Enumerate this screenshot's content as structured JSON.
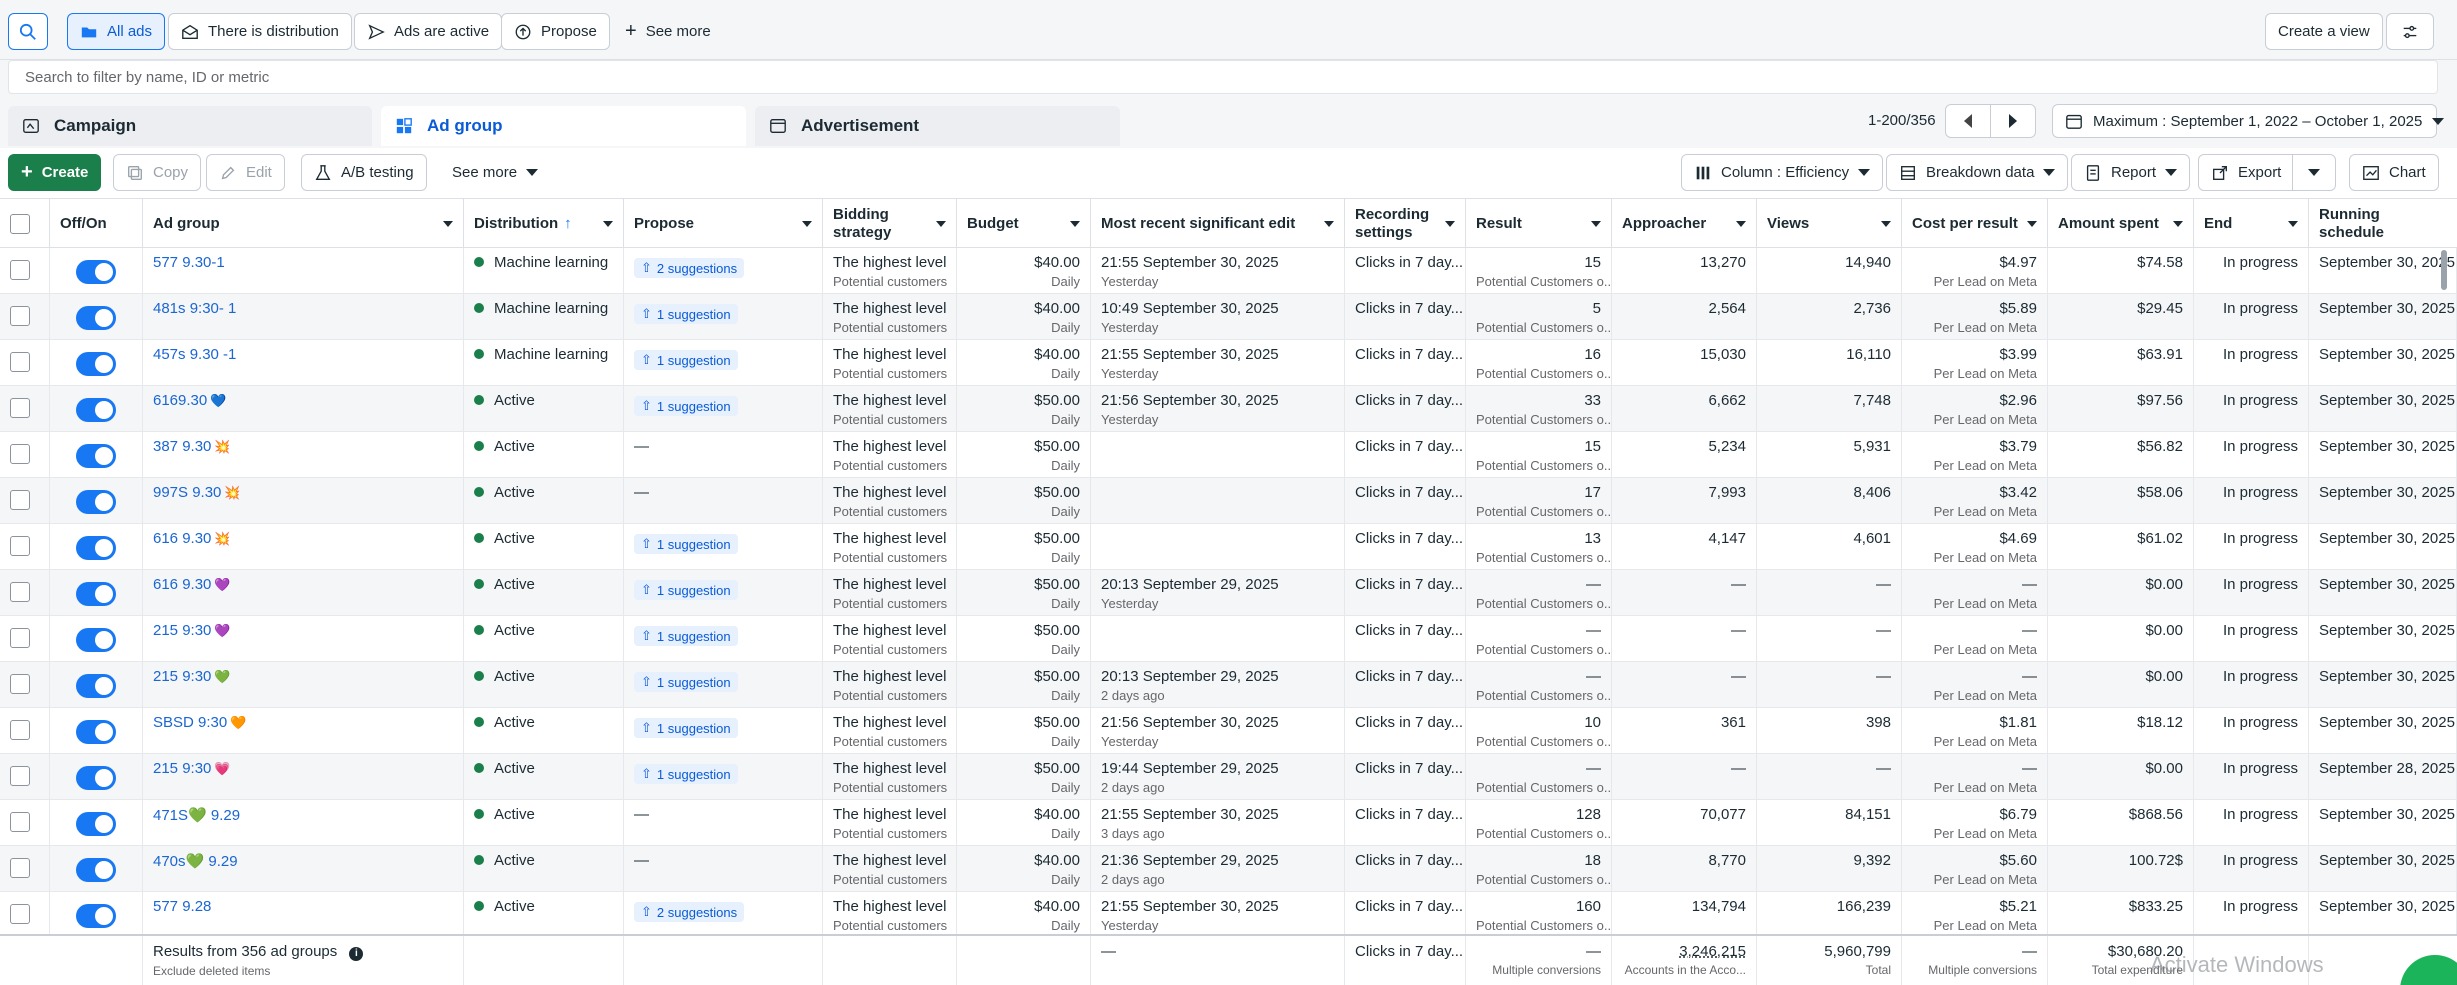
{
  "filters": {
    "all_ads": "All ads",
    "distribution": "There is distribution",
    "active": "Ads are active",
    "propose": "Propose",
    "see_more": "See more",
    "create_view": "Create a view"
  },
  "search": {
    "placeholder": "Search to filter by name, ID or metric"
  },
  "levels": {
    "campaign": "Campaign",
    "ad_group": "Ad group",
    "advertisement": "Advertisement"
  },
  "pager": {
    "range": "1-200/356"
  },
  "date_range": "Maximum : September 1, 2022 – October 1, 2025",
  "toolbar": {
    "create": "Create",
    "copy": "Copy",
    "edit": "Edit",
    "ab": "A/B testing",
    "see_more": "See more",
    "column": "Column : Efficiency",
    "breakdown": "Breakdown data",
    "report": "Report",
    "export": "Export",
    "chart": "Chart"
  },
  "columns": {
    "onoff": "Off/On",
    "adgroup": "Ad group",
    "distribution": "Distribution",
    "propose": "Propose",
    "bidding": "Bidding strategy",
    "budget": "Budget",
    "edit": "Most recent significant edit",
    "recording": "Recording settings",
    "result": "Result",
    "approacher": "Approacher",
    "views": "Views",
    "cpr": "Cost per result",
    "spent": "Amount spent",
    "end": "End",
    "schedule": "Running schedule"
  },
  "rows": [
    {
      "name": "577 9.30-1",
      "emoji": "",
      "dist": "Machine learning",
      "prop": "2 suggestions",
      "bid": "The highest level",
      "bid_sub": "Potential customers",
      "budget": "$40.00",
      "budget_sub": "Daily",
      "edit": "21:55 September 30, 2025",
      "edit_sub": "Yesterday",
      "rec": "Clicks in 7 day...",
      "result": "15",
      "result_sub": "Potential Customers o...",
      "appr": "13,270",
      "views": "14,940",
      "cpr": "$4.97",
      "cpr_sub": "Per Lead on Meta",
      "spent": "$74.58",
      "end": "In progress",
      "sched": "September 30, 2025"
    },
    {
      "name": "481s 9:30- 1",
      "emoji": "",
      "dist": "Machine learning",
      "prop": "1 suggestion",
      "bid": "The highest level",
      "bid_sub": "Potential customers",
      "budget": "$40.00",
      "budget_sub": "Daily",
      "edit": "10:49 September 30, 2025",
      "edit_sub": "Yesterday",
      "rec": "Clicks in 7 day...",
      "result": "5",
      "result_sub": "Potential Customers o...",
      "appr": "2,564",
      "views": "2,736",
      "cpr": "$5.89",
      "cpr_sub": "Per Lead on Meta",
      "spent": "$29.45",
      "end": "In progress",
      "sched": "September 30, 2025"
    },
    {
      "name": "457s 9.30 -1",
      "emoji": "",
      "dist": "Machine learning",
      "prop": "1 suggestion",
      "bid": "The highest level",
      "bid_sub": "Potential customers",
      "budget": "$40.00",
      "budget_sub": "Daily",
      "edit": "21:55 September 30, 2025",
      "edit_sub": "Yesterday",
      "rec": "Clicks in 7 day...",
      "result": "16",
      "result_sub": "Potential Customers o...",
      "appr": "15,030",
      "views": "16,110",
      "cpr": "$3.99",
      "cpr_sub": "Per Lead on Meta",
      "spent": "$63.91",
      "end": "In progress",
      "sched": "September 30, 2025"
    },
    {
      "name": "6169.30",
      "emoji": "💙",
      "dist": "Active",
      "prop": "1 suggestion",
      "bid": "The highest level",
      "bid_sub": "Potential customers",
      "budget": "$50.00",
      "budget_sub": "Daily",
      "edit": "21:56 September 30, 2025",
      "edit_sub": "Yesterday",
      "rec": "Clicks in 7 day...",
      "result": "33",
      "result_sub": "Potential Customers o...",
      "appr": "6,662",
      "views": "7,748",
      "cpr": "$2.96",
      "cpr_sub": "Per Lead on Meta",
      "spent": "$97.56",
      "end": "In progress",
      "sched": "September 30, 2025"
    },
    {
      "name": "387 9.30",
      "emoji": "💥",
      "dist": "Active",
      "prop": "—",
      "bid": "The highest level",
      "bid_sub": "Potential customers",
      "budget": "$50.00",
      "budget_sub": "Daily",
      "edit": "",
      "edit_sub": "",
      "rec": "Clicks in 7 day...",
      "result": "15",
      "result_sub": "Potential Customers o...",
      "appr": "5,234",
      "views": "5,931",
      "cpr": "$3.79",
      "cpr_sub": "Per Lead on Meta",
      "spent": "$56.82",
      "end": "In progress",
      "sched": "September 30, 2025"
    },
    {
      "name": "997S 9.30",
      "emoji": "💥",
      "dist": "Active",
      "prop": "—",
      "bid": "The highest level",
      "bid_sub": "Potential customers",
      "budget": "$50.00",
      "budget_sub": "Daily",
      "edit": "",
      "edit_sub": "",
      "rec": "Clicks in 7 day...",
      "result": "17",
      "result_sub": "Potential Customers o...",
      "appr": "7,993",
      "views": "8,406",
      "cpr": "$3.42",
      "cpr_sub": "Per Lead on Meta",
      "spent": "$58.06",
      "end": "In progress",
      "sched": "September 30, 2025"
    },
    {
      "name": "616 9.30",
      "emoji": "💥",
      "dist": "Active",
      "prop": "1 suggestion",
      "bid": "The highest level",
      "bid_sub": "Potential customers",
      "budget": "$50.00",
      "budget_sub": "Daily",
      "edit": "",
      "edit_sub": "",
      "rec": "Clicks in 7 day...",
      "result": "13",
      "result_sub": "Potential Customers o...",
      "appr": "4,147",
      "views": "4,601",
      "cpr": "$4.69",
      "cpr_sub": "Per Lead on Meta",
      "spent": "$61.02",
      "end": "In progress",
      "sched": "September 30, 2025"
    },
    {
      "name": "616 9.30",
      "emoji": "💜",
      "dist": "Active",
      "prop": "1 suggestion",
      "bid": "The highest level",
      "bid_sub": "Potential customers",
      "budget": "$50.00",
      "budget_sub": "Daily",
      "edit": "20:13 September 29, 2025",
      "edit_sub": "Yesterday",
      "rec": "Clicks in 7 day...",
      "result": "—",
      "result_sub": "Potential Customers o...",
      "appr": "—",
      "views": "—",
      "cpr": "—",
      "cpr_sub": "Per Lead on Meta",
      "spent": "$0.00",
      "end": "In progress",
      "sched": "September 30, 2025"
    },
    {
      "name": "215 9:30",
      "emoji": "💜",
      "dist": "Active",
      "prop": "1 suggestion",
      "bid": "The highest level",
      "bid_sub": "Potential customers",
      "budget": "$50.00",
      "budget_sub": "Daily",
      "edit": "",
      "edit_sub": "",
      "rec": "Clicks in 7 day...",
      "result": "—",
      "result_sub": "Potential Customers o...",
      "appr": "—",
      "views": "—",
      "cpr": "—",
      "cpr_sub": "Per Lead on Meta",
      "spent": "$0.00",
      "end": "In progress",
      "sched": "September 30, 2025"
    },
    {
      "name": "215 9:30",
      "emoji": "💚",
      "dist": "Active",
      "prop": "1 suggestion",
      "bid": "The highest level",
      "bid_sub": "Potential customers",
      "budget": "$50.00",
      "budget_sub": "Daily",
      "edit": "20:13 September 29, 2025",
      "edit_sub": "2 days ago",
      "rec": "Clicks in 7 day...",
      "result": "—",
      "result_sub": "Potential Customers o...",
      "appr": "—",
      "views": "—",
      "cpr": "—",
      "cpr_sub": "Per Lead on Meta",
      "spent": "$0.00",
      "end": "In progress",
      "sched": "September 30, 2025"
    },
    {
      "name": "SBSD 9:30",
      "emoji": "🧡",
      "dist": "Active",
      "prop": "1 suggestion",
      "bid": "The highest level",
      "bid_sub": "Potential customers",
      "budget": "$50.00",
      "budget_sub": "Daily",
      "edit": "21:56 September 30, 2025",
      "edit_sub": "Yesterday",
      "rec": "Clicks in 7 day...",
      "result": "10",
      "result_sub": "Potential Customers o...",
      "appr": "361",
      "views": "398",
      "cpr": "$1.81",
      "cpr_sub": "Per Lead on Meta",
      "spent": "$18.12",
      "end": "In progress",
      "sched": "September 30, 2025"
    },
    {
      "name": "215 9:30",
      "emoji": "💗",
      "dist": "Active",
      "prop": "1 suggestion",
      "bid": "The highest level",
      "bid_sub": "Potential customers",
      "budget": "$50.00",
      "budget_sub": "Daily",
      "edit": "19:44 September 29, 2025",
      "edit_sub": "2 days ago",
      "rec": "Clicks in 7 day...",
      "result": "—",
      "result_sub": "Potential Customers o...",
      "appr": "—",
      "views": "—",
      "cpr": "—",
      "cpr_sub": "Per Lead on Meta",
      "spent": "$0.00",
      "end": "In progress",
      "sched": "September 28, 2025"
    },
    {
      "name": "471S💚 9.29",
      "emoji": "",
      "dist": "Active",
      "prop": "—",
      "bid": "The highest level",
      "bid_sub": "Potential customers",
      "budget": "$40.00",
      "budget_sub": "Daily",
      "edit": "21:55 September 30, 2025",
      "edit_sub": "3 days ago",
      "rec": "Clicks in 7 day...",
      "result": "128",
      "result_sub": "Potential Customers o...",
      "appr": "70,077",
      "views": "84,151",
      "cpr": "$6.79",
      "cpr_sub": "Per Lead on Meta",
      "spent": "$868.56",
      "end": "In progress",
      "sched": "September 30, 2025"
    },
    {
      "name": "470s💚 9.29",
      "emoji": "",
      "dist": "Active",
      "prop": "—",
      "bid": "The highest level",
      "bid_sub": "Potential customers",
      "budget": "$40.00",
      "budget_sub": "Daily",
      "edit": "21:36 September 29, 2025",
      "edit_sub": "2 days ago",
      "rec": "Clicks in 7 day...",
      "result": "18",
      "result_sub": "Potential Customers o...",
      "appr": "8,770",
      "views": "9,392",
      "cpr": "$5.60",
      "cpr_sub": "Per Lead on Meta",
      "spent": "100.72$",
      "end": "In progress",
      "sched": "September 30, 2025"
    },
    {
      "name": "577 9.28",
      "emoji": "",
      "dist": "Active",
      "prop": "2 suggestions",
      "bid": "The highest level",
      "bid_sub": "Potential customers",
      "budget": "$40.00",
      "budget_sub": "Daily",
      "edit": "21:55 September 30, 2025",
      "edit_sub": "Yesterday",
      "rec": "Clicks in 7 day...",
      "result": "160",
      "result_sub": "Potential Customers o...",
      "appr": "134,794",
      "views": "166,239",
      "cpr": "$5.21",
      "cpr_sub": "Per Lead on Meta",
      "spent": "$833.25",
      "end": "In progress",
      "sched": "September 30, 2025"
    }
  ],
  "totals": {
    "label": "Results from 356 ad groups",
    "label_sub": "Exclude deleted items",
    "edit": "—",
    "rec": "Clicks in 7 day...",
    "result": "—",
    "result_sub": "Multiple conversions",
    "appr": "3,246,215",
    "appr_sub": "Accounts in the Acco...",
    "views": "5,960,799",
    "views_sub": "Total",
    "cpr": "—",
    "cpr_sub": "Multiple conversions",
    "spent": "$30,680.20",
    "spent_sub": "Total expenditure"
  },
  "watermark": "Activate Windows"
}
